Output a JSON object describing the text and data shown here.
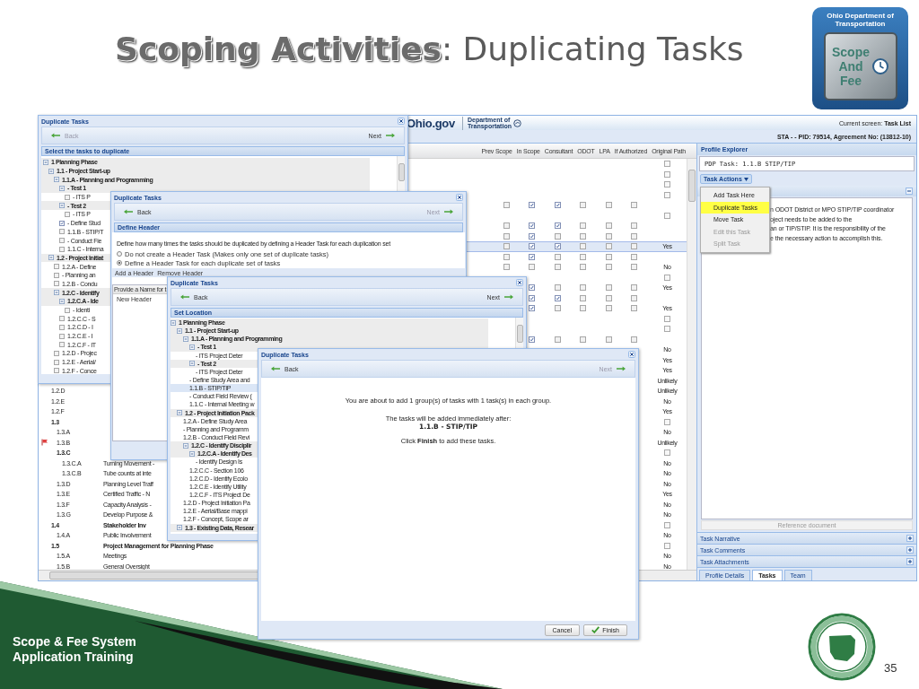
{
  "slide": {
    "title": "**Scoping Activities**: Duplicating Tasks",
    "footer_lines": [
      "Scope & Fee System",
      "Application Training"
    ],
    "page_number": "35"
  },
  "logo": {
    "agency_lines": [
      "Ohio Department of",
      "Transportation"
    ],
    "badge_lines": [
      "Scope",
      "And",
      "Fee"
    ]
  },
  "app": {
    "site_name": "Ohio.gov",
    "department_lines": [
      "Department of",
      "Transportation"
    ],
    "current_screen": "Current screen: **Task List**",
    "project_line": "STA - - PID: 79514, Agreement No: (13812-10)",
    "grid": {
      "columns": [
        "Prev Scope",
        "In Scope",
        "Consultant",
        "ODOT",
        "LPA",
        "If Authorized",
        "Original Path"
      ],
      "rows": [
        {
          "kind": "task",
          "selected": false,
          "flagged": false,
          "path_icon": true
        },
        {
          "kind": "task",
          "selected": false,
          "flagged": false,
          "path_icon": true
        },
        {
          "kind": "task",
          "selected": false,
          "flagged": false,
          "path_icon": true
        },
        {
          "kind": "task",
          "selected": false,
          "flagged": false,
          "path_icon": true
        },
        {
          "kind": "task",
          "selected": false,
          "flagged": false,
          "checks": {
            "prev_scope": false,
            "in_scope": true,
            "consultant": true,
            "odot": false,
            "lpa": false,
            "if_authorized": false
          },
          "path_icon": false
        },
        {
          "kind": "task",
          "selected": false,
          "flagged": false,
          "path_icon": true
        },
        {
          "kind": "task",
          "selected": false,
          "flagged": false,
          "checks": {
            "prev_scope": false,
            "in_scope": true,
            "consultant": true,
            "odot": false,
            "lpa": false,
            "if_authorized": false
          },
          "path_icon": false
        },
        {
          "kind": "task",
          "selected": false,
          "flagged": false,
          "checks": {
            "prev_scope": false,
            "in_scope": true,
            "consultant": false,
            "odot": false,
            "lpa": false,
            "if_authorized": false
          },
          "path_icon": false
        },
        {
          "kind": "task",
          "selected": true,
          "flagged": false,
          "checks": {
            "prev_scope": false,
            "in_scope": true,
            "consultant": true,
            "odot": false,
            "lpa": false,
            "if_authorized": false
          },
          "path_icon": false,
          "path": "Yes"
        },
        {
          "kind": "task",
          "selected": false,
          "flagged": false,
          "checks": {
            "prev_scope": false,
            "in_scope": true,
            "consultant": false,
            "odot": false,
            "lpa": false,
            "if_authorized": false
          },
          "path_icon": false
        },
        {
          "kind": "task",
          "selected": false,
          "flagged": false,
          "checks": {
            "prev_scope": false,
            "in_scope": false,
            "consultant": false,
            "odot": false,
            "lpa": false,
            "if_authorized": false
          },
          "path_icon": false,
          "path": "No"
        },
        {
          "kind": "task",
          "selected": false,
          "flagged": false,
          "path_icon": true
        },
        {
          "kind": "task",
          "selected": false,
          "flagged": false,
          "checks": {
            "in_scope": true,
            "consultant": false,
            "odot": false,
            "lpa": false,
            "if_authorized": false
          },
          "path_icon": false,
          "path": "Yes"
        },
        {
          "kind": "task",
          "selected": false,
          "flagged": false,
          "checks": {
            "in_scope": true,
            "consultant": true,
            "odot": false,
            "lpa": false,
            "if_authorized": false
          },
          "path_icon": false
        },
        {
          "kind": "task",
          "selected": false,
          "flagged": false,
          "checks": {
            "in_scope": true,
            "consultant": false,
            "odot": false,
            "lpa": false,
            "if_authorized": false
          },
          "path_icon": false,
          "path": "Yes"
        },
        {
          "kind": "task",
          "selected": false,
          "flagged": false,
          "path_icon": true
        },
        {
          "kind": "task",
          "selected": false,
          "flagged": false,
          "path_icon": true
        },
        {
          "kind": "task",
          "selected": false,
          "flagged": false,
          "checks": {
            "in_scope": true,
            "consultant": false,
            "odot": false,
            "lpa": false,
            "if_authorized": false
          },
          "path_icon": false
        },
        {
          "kind": "task",
          "selected": false,
          "flagged": false,
          "path_icon": false,
          "path": "No"
        },
        {
          "kind": "task",
          "selected": false,
          "flagged": false,
          "path_icon": false,
          "path": "Yes"
        },
        {
          "kind": "task",
          "selected": false,
          "flagged": false,
          "path_icon": false,
          "path": "Yes"
        },
        {
          "kind": "task",
          "selected": false,
          "flagged": false,
          "path_icon": false,
          "path": "Unlikely"
        },
        {
          "id": "1.2.D",
          "kind": "task",
          "selected": false,
          "flagged": false,
          "path_icon": false,
          "path": "Unlikely"
        },
        {
          "id": "1.2.E",
          "kind": "task",
          "selected": false,
          "flagged": false,
          "path_icon": false,
          "path": "No"
        },
        {
          "id": "1.2.F",
          "kind": "task",
          "selected": false,
          "flagged": false,
          "path_icon": false,
          "path": "Yes"
        },
        {
          "id": "1.3",
          "kind": "group",
          "selected": false,
          "flagged": false,
          "path_icon": true,
          "children": [
            {
              "id": "1.3.A",
              "kind": "task",
              "selected": false,
              "flagged": false,
              "path_icon": false,
              "path": "No"
            },
            {
              "id": "1.3.B",
              "kind": "task",
              "selected": false,
              "flagged": true,
              "path_icon": false,
              "path": "Unlikely"
            },
            {
              "id": "1.3.C",
              "kind": "group",
              "selected": false,
              "flagged": false,
              "path_icon": true,
              "children": [
                {
                  "id": "1.3.C.A",
                  "name": "Turning Movement -",
                  "kind": "task",
                  "selected": false,
                  "flagged": false,
                  "path_icon": false,
                  "path": "No"
                },
                {
                  "id": "1.3.C.B",
                  "name": "Tube counts at inte",
                  "kind": "task",
                  "selected": false,
                  "flagged": false,
                  "path_icon": false,
                  "path": "No"
                }
              ]
            },
            {
              "id": "1.3.D",
              "name": "Planning Level Traff",
              "kind": "task",
              "selected": false,
              "flagged": false,
              "path_icon": false,
              "path": "No"
            },
            {
              "id": "1.3.E",
              "name": "Certified Traffic - N",
              "kind": "task",
              "selected": false,
              "flagged": false,
              "path_icon": false,
              "path": "Yes"
            },
            {
              "id": "1.3.F",
              "name": "Capacity Analysis -",
              "kind": "task",
              "selected": false,
              "flagged": false,
              "path_icon": false,
              "path": "No"
            },
            {
              "id": "1.3.G",
              "name": "Develop Purpose &",
              "kind": "task",
              "selected": false,
              "flagged": false,
              "path_icon": false,
              "path": "No"
            }
          ]
        },
        {
          "id": "1.4",
          "name": "Stakeholder Inv",
          "kind": "group",
          "selected": false,
          "flagged": false,
          "path_icon": true,
          "children": [
            {
              "id": "1.4.A",
              "name": "Public Involvement",
              "kind": "task",
              "selected": false,
              "flagged": false,
              "path_icon": false,
              "path": "No"
            }
          ]
        },
        {
          "id": "1.5",
          "name": "Project Management for Planning Phase",
          "kind": "group",
          "selected": false,
          "flagged": false,
          "path_icon": true,
          "children": [
            {
              "id": "1.5.A",
              "name": "Meetings",
              "kind": "task",
              "selected": false,
              "flagged": false,
              "path_icon": false,
              "path": "No"
            },
            {
              "id": "1.5.B",
              "name": "General Oversight",
              "kind": "task",
              "selected": false,
              "flagged": false,
              "path_icon": false,
              "path": "No"
            }
          ]
        }
      ]
    },
    "profile": {
      "title": "Profile Explorer",
      "task_field": "PDP Task: 1.1.B STIP/TIP",
      "actions_button": "Task Actions",
      "menu": [
        {
          "label": "Add Task Here",
          "selected": false,
          "disabled": false
        },
        {
          "label": "Duplicate Tasks",
          "selected": true,
          "disabled": false
        },
        {
          "label": "Move Task",
          "selected": false,
          "disabled": false
        },
        {
          "label": "Edit this Task",
          "selected": false,
          "disabled": true
        },
        {
          "label": "Split Task",
          "selected": false,
          "disabled": true
        }
      ],
      "description_fragments": [
        "n ODOT District or MPO STIP/TIP coordinator",
        "oject needs to be added to the",
        "an or TIP/STIP. It is the responsibility of the",
        "e the necessary action to accomplish this."
      ],
      "reference_button": "Reference document",
      "sections": [
        "Task Narrative",
        "Task Comments",
        "Task Attachments"
      ],
      "tabs": [
        {
          "label": "Profile Details",
          "selected": false
        },
        {
          "label": "Tasks",
          "selected": true
        },
        {
          "label": "Team",
          "selected": false
        }
      ]
    }
  },
  "dialogs": [
    {
      "kind": "select",
      "title": "Duplicate Tasks",
      "back": {
        "label": "Back",
        "disabled": true
      },
      "next": {
        "label": "Next",
        "disabled": false
      },
      "section": "Select the tasks to duplicate",
      "tree": [
        {
          "label": "1 Planning Phase",
          "kind": "group",
          "expanded": true,
          "children": [
            {
              "label": "1.1 - Project Start-up",
              "kind": "group",
              "expanded": true,
              "children": [
                {
                  "label": "1.1.A - Planning and Programming",
                  "kind": "group",
                  "expanded": true,
                  "children": [
                    {
                      "label": "- Test 1",
                      "kind": "group",
                      "expanded": true,
                      "children": [
                        {
                          "label": "- ITS P",
                          "kind": "task",
                          "checked": false
                        }
                      ]
                    },
                    {
                      "label": "- Test 2",
                      "kind": "group",
                      "expanded": true,
                      "children": [
                        {
                          "label": "- ITS P",
                          "kind": "task",
                          "checked": false
                        }
                      ]
                    },
                    {
                      "label": "- Define Stud",
                      "kind": "task",
                      "checked": true
                    },
                    {
                      "label": "1.1.B - STIP/T",
                      "kind": "task",
                      "checked": false
                    },
                    {
                      "label": "- Conduct Fie",
                      "kind": "task",
                      "checked": false
                    },
                    {
                      "label": "1.1.C - Interna",
                      "kind": "task",
                      "checked": false
                    }
                  ]
                }
              ]
            },
            {
              "label": "1.2 - Project Initiat",
              "kind": "group",
              "expanded": true,
              "children": [
                {
                  "label": "1.2.A - Define",
                  "kind": "task",
                  "checked": false
                },
                {
                  "label": "- Planning an",
                  "kind": "task",
                  "checked": false
                },
                {
                  "label": "1.2.B - Condu",
                  "kind": "task",
                  "checked": false
                },
                {
                  "label": "1.2.C - Identify",
                  "kind": "group",
                  "expanded": true,
                  "children": [
                    {
                      "label": "1.2.C.A - Ide",
                      "kind": "group",
                      "expanded": true,
                      "children": [
                        {
                          "label": "- Identi",
                          "kind": "task",
                          "checked": false
                        }
                      ]
                    },
                    {
                      "label": "1.2.C.C - S",
                      "kind": "task",
                      "checked": false
                    },
                    {
                      "label": "1.2.C.D - I",
                      "kind": "task",
                      "checked": false
                    },
                    {
                      "label": "1.2.C.E - I",
                      "kind": "task",
                      "checked": false
                    },
                    {
                      "label": "1.2.C.F - IT",
                      "kind": "task",
                      "checked": false
                    }
                  ]
                },
                {
                  "label": "1.2.D - Projec",
                  "kind": "task",
                  "checked": false
                },
                {
                  "label": "1.2.E - Aerial/",
                  "kind": "task",
                  "checked": false
                },
                {
                  "label": "1.2.F - Conce",
                  "kind": "task",
                  "checked": false
                }
              ]
            }
          ]
        }
      ]
    },
    {
      "kind": "header",
      "title": "Duplicate Tasks",
      "back": {
        "label": "Back",
        "disabled": false
      },
      "next": {
        "label": "Next",
        "disabled": true
      },
      "section": "Define Header",
      "intro": "Define how many times the tasks should be duplicated by defining a Header Task for each duplication set",
      "options": [
        {
          "label": "Do not create a Header Task (Makes only one set of duplicate tasks)",
          "selected": false
        },
        {
          "label": "Define a Header Task for each duplicate set of tasks",
          "selected": true
        }
      ],
      "toolbar": [
        "Add a Header",
        "Remove Header"
      ],
      "name_column": "Provide a Name for t",
      "names": [
        "New Header"
      ]
    },
    {
      "kind": "location",
      "title": "Duplicate Tasks",
      "back": {
        "label": "Back",
        "disabled": false
      },
      "next": {
        "label": "Next",
        "disabled": false
      },
      "section": "Set Location",
      "tree": [
        {
          "label": "1 Planning Phase",
          "kind": "group",
          "expanded": true,
          "selected": false,
          "children": [
            {
              "label": "1.1 - Project Start-up",
              "kind": "group",
              "expanded": true,
              "selected": false,
              "children": [
                {
                  "label": "1.1.A - Planning and Programming",
                  "kind": "group",
                  "expanded": true,
                  "selected": false,
                  "children": [
                    {
                      "label": "- Test 1",
                      "kind": "group",
                      "expanded": true,
                      "selected": false,
                      "children": [
                        {
                          "label": "- ITS Project Deter",
                          "kind": "task",
                          "selected": false
                        }
                      ]
                    },
                    {
                      "label": "- Test 2",
                      "kind": "group",
                      "expanded": true,
                      "selected": false,
                      "children": [
                        {
                          "label": "- ITS Project Deter",
                          "kind": "task",
                          "selected": false
                        }
                      ]
                    },
                    {
                      "label": "- Define Study Area and",
                      "kind": "task",
                      "selected": false
                    },
                    {
                      "label": "1.1.B - STIP/TIP",
                      "kind": "task",
                      "selected": true
                    },
                    {
                      "label": "- Conduct Field Review (",
                      "kind": "task",
                      "selected": false
                    },
                    {
                      "label": "1.1.C - Internal Meeting w",
                      "kind": "task",
                      "selected": false
                    }
                  ]
                }
              ]
            },
            {
              "label": "1.2 - Project Initiation Pack",
              "kind": "group",
              "expanded": true,
              "selected": false,
              "children": [
                {
                  "label": "1.2.A - Define Study Area",
                  "kind": "task",
                  "selected": false
                },
                {
                  "label": "- Planning and Programm",
                  "kind": "task",
                  "selected": false
                },
                {
                  "label": "1.2.B - Conduct Field Revi",
                  "kind": "task",
                  "selected": false
                },
                {
                  "label": "1.2.C - Identify Disciplir",
                  "kind": "group",
                  "expanded": true,
                  "selected": false,
                  "children": [
                    {
                      "label": "1.2.C.A - Identify Des",
                      "kind": "group",
                      "expanded": true,
                      "selected": false,
                      "children": [
                        {
                          "label": "- Identify Design Is",
                          "kind": "task",
                          "selected": false
                        }
                      ]
                    },
                    {
                      "label": "1.2.C.C - Section 106",
                      "kind": "task",
                      "selected": false
                    },
                    {
                      "label": "1.2.C.D - Identify Ecolo",
                      "kind": "task",
                      "selected": false
                    },
                    {
                      "label": "1.2.C.E - Identify Utility",
                      "kind": "task",
                      "selected": false
                    },
                    {
                      "label": "1.2.C.F - ITS Project De",
                      "kind": "task",
                      "selected": false
                    }
                  ]
                },
                {
                  "label": "1.2.D - Project Initiation Pa",
                  "kind": "task",
                  "selected": false
                },
                {
                  "label": "1.2.E - Aerial/Base mappi",
                  "kind": "task",
                  "selected": false
                },
                {
                  "label": "1.2.F - Concept, Scope ar",
                  "kind": "task",
                  "selected": false
                }
              ]
            },
            {
              "label": "1.3 - Existing Data, Resear",
              "kind": "group",
              "expanded": true,
              "selected": false
            }
          ]
        }
      ]
    },
    {
      "kind": "confirm",
      "title": "Duplicate Tasks",
      "back": {
        "label": "Back",
        "disabled": false
      },
      "next": {
        "label": "Next",
        "disabled": true
      },
      "message": "You are about to add 1 group(s) of tasks with 1 task(s) in each group.",
      "after_label": "The tasks will be added immediately after:",
      "target": "1.1.B - STIP/TIP",
      "instruction": "Click **Finish** to add these tasks.",
      "buttons": [
        {
          "label": "Cancel",
          "kind": "plain"
        },
        {
          "label": "Finish",
          "kind": "confirm"
        }
      ]
    }
  ]
}
